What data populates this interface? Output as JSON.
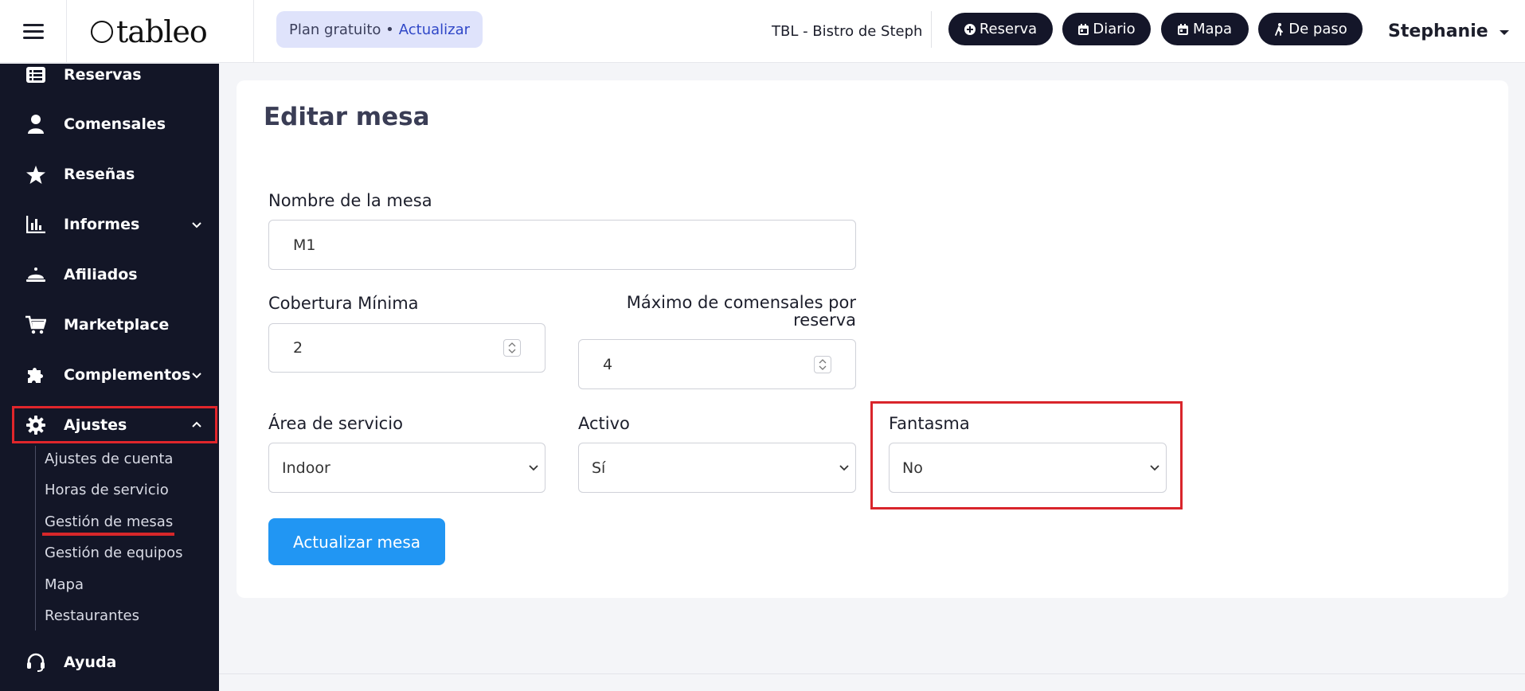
{
  "topbar": {
    "logo_text": "tableo",
    "plan_label": "Plan gratuito •",
    "plan_upgrade": "Actualizar",
    "restaurant": "TBL - Bistro de Steph",
    "buttons": [
      {
        "label": "Reserva",
        "icon": "plus-circle-icon"
      },
      {
        "label": "Diario",
        "icon": "calendar-icon"
      },
      {
        "label": "Mapa",
        "icon": "calendar-icon"
      },
      {
        "label": "De paso",
        "icon": "walking-icon"
      }
    ],
    "user": "Stephanie"
  },
  "sidebar": {
    "items": [
      {
        "label": "Reservas",
        "icon": "list-icon"
      },
      {
        "label": "Comensales",
        "icon": "user-icon"
      },
      {
        "label": "Reseñas",
        "icon": "star-icon"
      },
      {
        "label": "Informes",
        "icon": "bar-chart-icon",
        "expandable": true
      },
      {
        "label": "Afiliados",
        "icon": "bell-icon"
      },
      {
        "label": "Marketplace",
        "icon": "cart-icon"
      },
      {
        "label": "Complementos",
        "icon": "puzzle-icon",
        "expandable": true
      },
      {
        "label": "Ajustes",
        "icon": "gear-icon",
        "expanded": true
      },
      {
        "label": "Ayuda",
        "icon": "headset-icon"
      }
    ],
    "subitems": [
      "Ajustes de cuenta",
      "Horas de servicio",
      "Gestión de mesas",
      "Gestión de equipos",
      "Mapa",
      "Restaurantes"
    ],
    "active_subitem": "Gestión de mesas"
  },
  "form": {
    "title": "Editar mesa",
    "table_name_label": "Nombre de la mesa",
    "table_name_value": "M1",
    "min_cover_label": "Cobertura Mínima",
    "min_cover_value": "2",
    "max_guests_label_line1": "Máximo de comensales por",
    "max_guests_label_line2": "reserva",
    "max_guests_value": "4",
    "service_area_label": "Área de servicio",
    "service_area_value": "Indoor",
    "active_label": "Activo",
    "active_value": "Sí",
    "ghost_label": "Fantasma",
    "ghost_value": "No",
    "submit_label": "Actualizar mesa"
  },
  "colors": {
    "sidebar_bg": "#131627",
    "primary": "#2196f3",
    "highlight": "#d9252b",
    "nav_button": "#141629",
    "plan_bg": "#dfe3fb"
  }
}
